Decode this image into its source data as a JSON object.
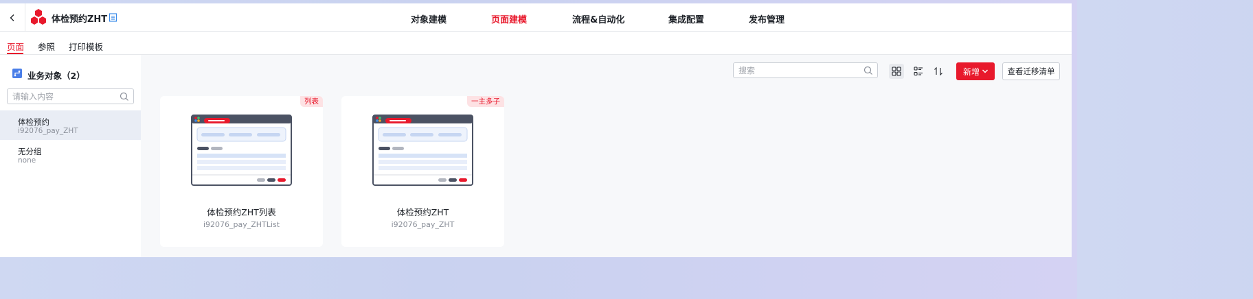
{
  "header": {
    "app_title": "体检预约ZHT",
    "nav": [
      {
        "label": "对象建模",
        "active": false
      },
      {
        "label": "页面建模",
        "active": true
      },
      {
        "label": "流程&自动化",
        "active": false
      },
      {
        "label": "集成配置",
        "active": false
      },
      {
        "label": "发布管理",
        "active": false
      }
    ]
  },
  "subtabs": [
    {
      "label": "页面",
      "active": true
    },
    {
      "label": "参照",
      "active": false
    },
    {
      "label": "打印模板",
      "active": false
    }
  ],
  "sidebar": {
    "title": "业务对象（2）",
    "search_placeholder": "请输入内容",
    "items": [
      {
        "name": "体检预约",
        "code": "i92076_pay_ZHT",
        "selected": true
      },
      {
        "name": "无分组",
        "code": "none",
        "selected": false
      }
    ]
  },
  "toolbar": {
    "search_placeholder": "搜索",
    "new_label": "新增",
    "migrate_label": "查看迁移清单",
    "icons": [
      "grid-view-icon",
      "list-view-icon",
      "sort-icon"
    ]
  },
  "cards": [
    {
      "tag": "列表",
      "name": "体检预约ZHT列表",
      "code": "i92076_pay_ZHTList"
    },
    {
      "tag": "一主多子",
      "name": "体检预约ZHT",
      "code": "i92076_pay_ZHT"
    }
  ],
  "colors": {
    "accent": "#e8192c",
    "tag_bg": "#fde2e4",
    "selected_bg": "#e9edf5",
    "page_bg": "#f7f8fa",
    "thumb_frame": "#4b5263"
  }
}
